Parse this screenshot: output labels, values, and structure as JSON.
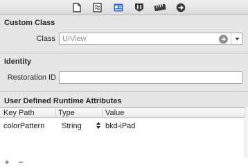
{
  "colors": {
    "selected_tab": "#2a6ad6",
    "icon_gray": "#3c3c3c",
    "field_border": "#a9a9a9",
    "section_bg": "#e6e6e6"
  },
  "toolbar": {
    "tabs": [
      {
        "icon": "file-inspector-icon"
      },
      {
        "icon": "quick-help-icon"
      },
      {
        "icon": "identity-inspector-icon",
        "selected": true
      },
      {
        "icon": "attributes-inspector-icon"
      },
      {
        "icon": "size-inspector-icon"
      },
      {
        "icon": "connections-inspector-icon"
      }
    ]
  },
  "custom_class": {
    "title": "Custom Class",
    "class_label": "Class",
    "class_value": "UIView"
  },
  "identity": {
    "title": "Identity",
    "restoration_id_label": "Restoration ID",
    "restoration_id_value": ""
  },
  "runtime_attributes": {
    "title": "User Defined Runtime Attributes",
    "columns": [
      "Key Path",
      "Type",
      "Value"
    ],
    "rows": [
      {
        "key_path": "colorPattern",
        "type": "String",
        "value": "bkd-iPad"
      }
    ]
  },
  "bottom_bar": {
    "add_label": "+",
    "remove_label": "−"
  }
}
